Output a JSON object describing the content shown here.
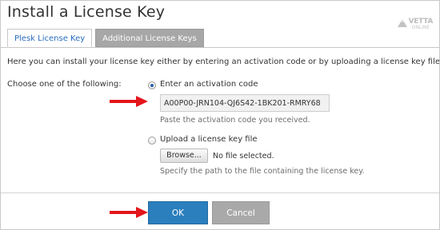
{
  "page": {
    "title": "Install a License Key"
  },
  "brand": {
    "name": "VETTA",
    "sub": "ONLINE"
  },
  "tabs": [
    {
      "label": "Plesk License Key",
      "active": true
    },
    {
      "label": "Additional License Keys",
      "active": false
    }
  ],
  "intro_text": "Here you can install your license key either by entering an activation code or by uploading a license key file.",
  "choice": {
    "label": "Choose one of the following:",
    "options": [
      {
        "label": "Enter an activation code",
        "selected": true,
        "input_value": "A00P00-JRN104-QJ6S42-1BK201-RMRY68",
        "hint": "Paste the activation code you received."
      },
      {
        "label": "Upload a license key file",
        "selected": false,
        "browse_label": "Browse...",
        "file_status": "No file selected.",
        "hint": "Specify the path to the file containing the license key."
      }
    ]
  },
  "buttons": {
    "ok": "OK",
    "cancel": "Cancel"
  },
  "colors": {
    "accent": "#2b7fbd",
    "arrow": "#e3151b",
    "tab_active_text": "#2a6cbf",
    "tab_inactive_bg": "#a7a7a7"
  }
}
